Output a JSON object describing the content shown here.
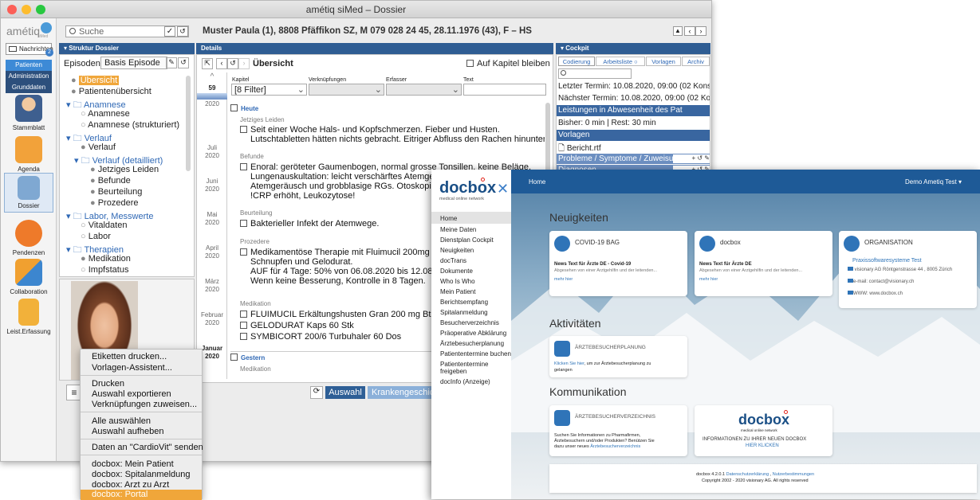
{
  "window": {
    "title": "amétiq siMed – Dossier"
  },
  "sidebar": {
    "logo": "amétiq",
    "logo_sub": "siMed",
    "messages_label": "Nachrichten",
    "messages_badge": "2",
    "tabs": [
      "Patienten",
      "Administration",
      "Grunddaten"
    ],
    "apps": [
      "Stammblatt",
      "Agenda",
      "Dossier",
      "Pendenzen",
      "Collaboration",
      "Leist.Erfassung"
    ]
  },
  "search": {
    "placeholder": "Suche"
  },
  "patient": {
    "header": "Muster Paula (1), 8808 Pfäffikon SZ, M 079 028 24 45, 28.11.1976 (43), F – HS"
  },
  "structure": {
    "title": "Struktur Dossier",
    "episodes_label": "Episoden:",
    "episodes_value": "Basis Episode",
    "items": [
      "Übersicht",
      "Patientenübersicht",
      "Anamnese",
      "Anamnese",
      "Anamnese (strukturiert)",
      "Verlauf",
      "Verlauf",
      "Verlauf (detailliert)",
      "Jetziges Leiden",
      "Befunde",
      "Beurteilung",
      "Prozedere",
      "Labor, Messwerte",
      "Vitaldaten",
      "Labor",
      "Therapien",
      "Medikation",
      "Impfstatus"
    ]
  },
  "details": {
    "title": "Details",
    "view_title": "Übersicht",
    "stay_on_chapter": "Auf Kapitel bleiben",
    "filter_headers": [
      "Kapitel",
      "Verknüpfungen",
      "Erfasser",
      "Text"
    ],
    "filter_value": "[8 Filter]",
    "timeline": [
      "59",
      "2020",
      "Juli",
      "2020",
      "Juni",
      "2020",
      "Mai",
      "2020",
      "April",
      "2020",
      "März",
      "2020",
      "Februar",
      "2020",
      "Januar",
      "2020"
    ],
    "sections": {
      "today": "Heute",
      "yesterday": "Gestern"
    },
    "entries": [
      {
        "label": "Jetziges Leiden",
        "lines": [
          "Seit einer Woche Hals- und Kopfschmerzen. Fieber und Husten.",
          "Lutschtabletten hätten nichts gebracht. Eitriger Abfluss den Rachen hinunter."
        ]
      },
      {
        "label": "Befunde",
        "lines": [
          "Enoral: geröteter Gaumenbogen, normal grosse Tonsillen, keine Beläge.",
          "Lungenauskultation: leicht verschärftes Atemgeräusch li",
          "Atemgeräusch und grobblasige RGs. Otoskopie bds blan",
          "!CRP erhöht, Leukozytose!"
        ]
      },
      {
        "label": "Beurteilung",
        "lines": [
          "Bakterieller Infekt der Atemwege."
        ]
      },
      {
        "label": "Prozedere",
        "lines": [
          "Medikamentöse Therapie mit Fluimucil 200mg 1-0-1 / S",
          "Schnupfen und Gelodurat.",
          "AUF für 4 Tage: 50% von 06.08.2020 bis 12.08.2020.",
          "Wenn keine Besserung, Kontrolle in 8 Tagen."
        ]
      },
      {
        "label": "Medikation",
        "lines": [
          "FLUIMUCIL Erkältungshusten Gran 200 mg Btl 20 Stk",
          "GELODURAT Kaps 60 Stk",
          "SYMBICORT 200/6 Turbuhaler 60 Dos"
        ]
      }
    ],
    "yesterday_label": "Medikation",
    "btn_select": "Auswahl",
    "btn_kg": "Krankengeschich"
  },
  "cockpit": {
    "title": "Cockpit",
    "tabs": [
      "Codierung",
      "Arbeitsliste",
      "Vorlagen",
      "Archiv"
    ],
    "last": "Letzter Termin: 10.08.2020, 09:00 (02 Konsu",
    "next": "Nächster Termin: 10.08.2020, 09:00 (02 Kon",
    "absence_head": "Leistungen in Abwesenheit des Pat",
    "absence_text": "Bisher: 0 min | Rest: 30 min",
    "templates_head": "Vorlagen",
    "template_file": "Bericht.rtf",
    "problems_head": "Probleme / Symptome / Zuweisung",
    "diagnoses_head": "Diagnosen"
  },
  "context_menu": {
    "items": [
      "Etiketten drucken...",
      "Vorlagen-Assistent...",
      "Drucken",
      "Auswahl exportieren",
      "Verknüpfungen zuweisen...",
      "Alle auswählen",
      "Auswahl aufheben",
      "Daten an \"CardioVit\" senden",
      "docbox: Mein Patient",
      "docbox: Spitalanmeldung",
      "docbox: Arzt zu Arzt",
      "docbox: Portal"
    ]
  },
  "docbox": {
    "logo": "docbox",
    "logo_sub": "medical online network",
    "topbar_title": "Home",
    "user": "Demo Ametiq Test",
    "nav": [
      "Home",
      "Meine Daten",
      "Dienstplan Cockpit",
      "Neuigkeiten",
      "docTrans",
      "Dokumente",
      "Who Is Who",
      "Mein Patient",
      "Berichtsempfang",
      "Spitalanmeldung",
      "Besucherverzeichnis",
      "Präoperative Abklärung",
      "Ärztebesucherplanung",
      "Patiententermine buchen",
      "Patiententermine freigeben",
      "docInfo (Anzeige)"
    ],
    "h_news": "Neuigkeiten",
    "h_activities": "Aktivitäten",
    "h_comm": "Kommunikation",
    "cards": {
      "covid_title": "COVID-19 BAG",
      "covid_head": "News Text für Ärzte DE - Covid-19",
      "covid_sub": "Abgesehen von einer Arztgehilfin und der leitenden...",
      "docbox_title": "docbox",
      "docbox_head": "News Text für Ärzte DE",
      "docbox_sub": "Abgesehen von einer Arztgehilfin und der leitenden...",
      "more": "mehr hier",
      "org_title": "ORGANISATION",
      "org_name": "Praxissoftwaresysteme Test",
      "org_addr": "visionary AG Röntgenstrasse 44 , 8005 Zürich",
      "org_mail": "e-mail: contact@visionary.ch",
      "org_www": "WWW: www.docbox.ch",
      "plan_title": "ÄRZTEBESUCHERPLANUNG",
      "plan_text1": "Klicken Sie hier",
      "plan_text2": ", um zur Ärztebesucherplanung zu",
      "plan_text3": "gelangen",
      "dir_title": "ÄRZTEBESUCHERVERZEICHNIS",
      "dir_text1": "Suchen Sie Informationen zu Pharmafirmen,",
      "dir_text2": "Ärztebesuchern und/oder Produkten? Benützen Sie",
      "dir_text3": "dazu unser neues",
      "dir_link": "Ärztebesucherverzeichnis",
      "new_title": "INFORMATIONEN ZU IHRER NEUEN DOCBOX",
      "new_link": "HIER KLICKEN"
    },
    "footer1": "docbox 4.2.0.1",
    "footer_link1": "Datenschutzerklärung",
    "footer_link2": "Nutzerbestimmungen",
    "footer2": "Copyright 2002 - 2020 visionary AG. All rights reserved"
  },
  "colors": {
    "accent": "#2f5d93",
    "selected": "#f0a63a",
    "docbox_blue": "#1e5a97",
    "docbox_red": "#e2231a"
  }
}
